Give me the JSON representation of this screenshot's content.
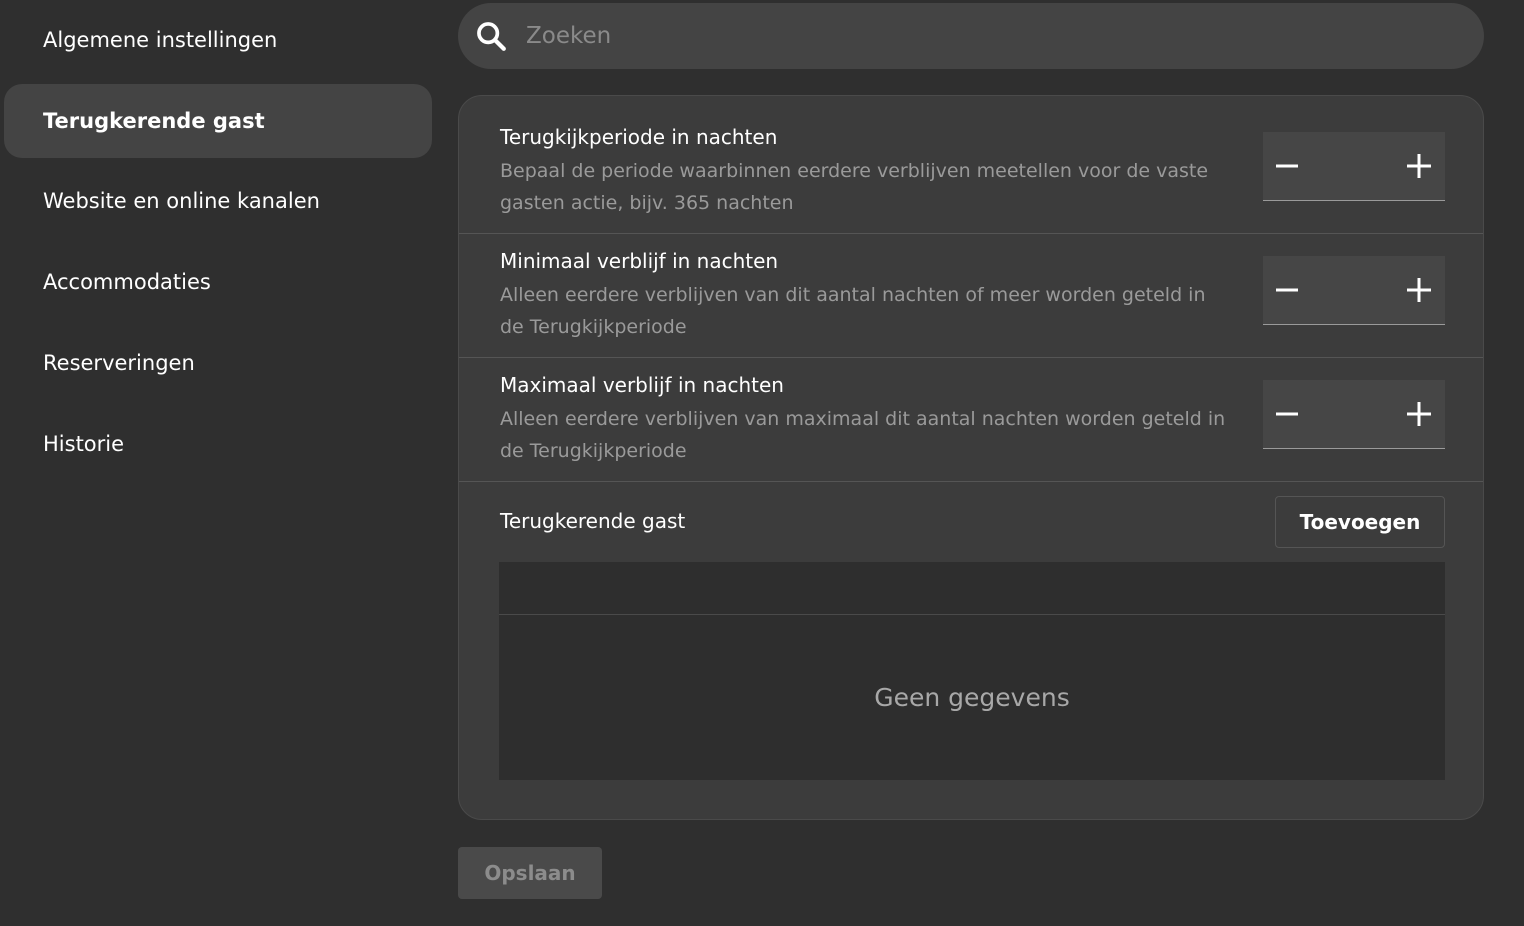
{
  "sidebar": {
    "items": [
      {
        "label": "Algemene instellingen",
        "active": false
      },
      {
        "label": "Terugkerende gast",
        "active": true
      },
      {
        "label": "Website en online kanalen",
        "active": false
      },
      {
        "label": "Accommodaties",
        "active": false
      },
      {
        "label": "Reserveringen",
        "active": false
      },
      {
        "label": "Historie",
        "active": false
      }
    ]
  },
  "search": {
    "placeholder": "Zoeken",
    "icon": "search-icon"
  },
  "settings": [
    {
      "title": "Terugkijkperiode in nachten",
      "description": "Bepaal de periode waarbinnen eerdere verblijven meetellen voor de vaste gasten actie, bijv. 365 nachten",
      "value": ""
    },
    {
      "title": "Minimaal verblijf in nachten",
      "description": "Alleen eerdere verblijven van dit aantal nachten of meer worden geteld in de Terugkijkperiode",
      "value": ""
    },
    {
      "title": "Maximaal verblijf in nachten",
      "description": "Alleen eerdere verblijven van maximaal dit aantal nachten worden geteld in de Terugkijkperiode",
      "value": ""
    }
  ],
  "guest_section": {
    "title": "Terugkerende gast",
    "add_label": "Toevoegen",
    "empty_text": "Geen gegevens"
  },
  "actions": {
    "save_label": "Opslaan"
  },
  "colors": {
    "background": "#2f2f2f",
    "card": "#3c3c3c",
    "active_item": "#444444",
    "muted_text": "#9a9a9a"
  }
}
